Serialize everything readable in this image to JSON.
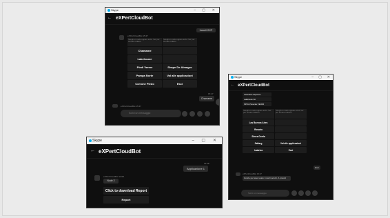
{
  "window1": {
    "app": "Skype",
    "title": "eXPertCloudBot",
    "sent_top": "Inoculi GCP",
    "sender": "eXPertCloudBot 15:47",
    "caption_left": "Scegli un nodo oppure scrivi 'Go' per tornare indietro",
    "caption_right": "Scegli un nodo oppure scrivi 'Go' per tornare indietro",
    "buttons": [
      "Chamame",
      "Lakehouse",
      "Piedi Verme",
      "Shape De Almagro",
      "Pampa Norte",
      "Val alle applicazioni",
      "Corrone Piedo",
      "Esci"
    ],
    "time_label": "15:47",
    "sent_bottom": "Chamame",
    "sender_bottom": "eXPertCloudBot 15:47",
    "input_placeholder": "Scrivi un messaggio"
  },
  "window2": {
    "app": "Skype",
    "title": "eXPertCloudBot",
    "top_items": [
      "Lavoratore riapertura",
      "Lakehouse 3H",
      "NPCG Presenter VECNR"
    ],
    "caption_left": "Scegli un nodo oppure scrivi 'Go' per tornare indietro",
    "caption_right": "Scegli un nodo oppure scrivi 'Go' per tornare indietro",
    "buttons": [
      "Las Buenos Aires",
      "Rosario",
      "Sierra Gorda",
      "Saltarg",
      "Val alle applicazioni",
      "Inabrica",
      "Esci"
    ],
    "sent_small": "Esci",
    "sender": "eXPertCloudBot 15:47",
    "message": "Grazie per aver usato i nostri servizi, A presto!",
    "input_placeholder": "Scrivi un messaggio"
  },
  "window3": {
    "app": "Skype",
    "title": "eXPertCloudBot",
    "time_label": "13:08",
    "sent": "Applicazione 1",
    "sender": "eXPertCloudBot 13:08",
    "node_label": "Node 2",
    "card_title": "Click to download Report",
    "card_button": "Report"
  }
}
